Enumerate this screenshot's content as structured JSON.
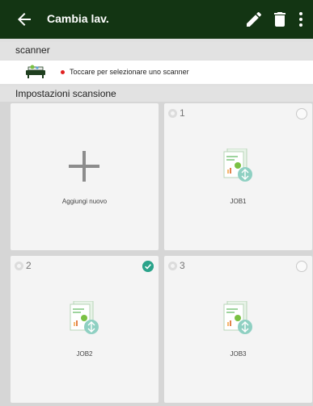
{
  "appbar": {
    "title": "Cambia lav.",
    "icons": [
      "back-arrow-icon",
      "edit-pencil-icon",
      "delete-trash-icon",
      "more-vert-icon"
    ],
    "bg": "#133513"
  },
  "scanner_section": {
    "title": "scanner",
    "status_text": "Toccare per selezionare uno scanner",
    "status_color": "#e02020"
  },
  "settings_section": {
    "title": "Impostazioni scansione"
  },
  "tiles": {
    "add_label": "Aggiungi nuovo",
    "jobs": [
      {
        "number": "1",
        "label": "JOB1",
        "selected": false
      },
      {
        "number": "2",
        "label": "JOB2",
        "selected": true
      },
      {
        "number": "3",
        "label": "JOB3",
        "selected": false
      }
    ],
    "accent": "#2aa38a"
  }
}
